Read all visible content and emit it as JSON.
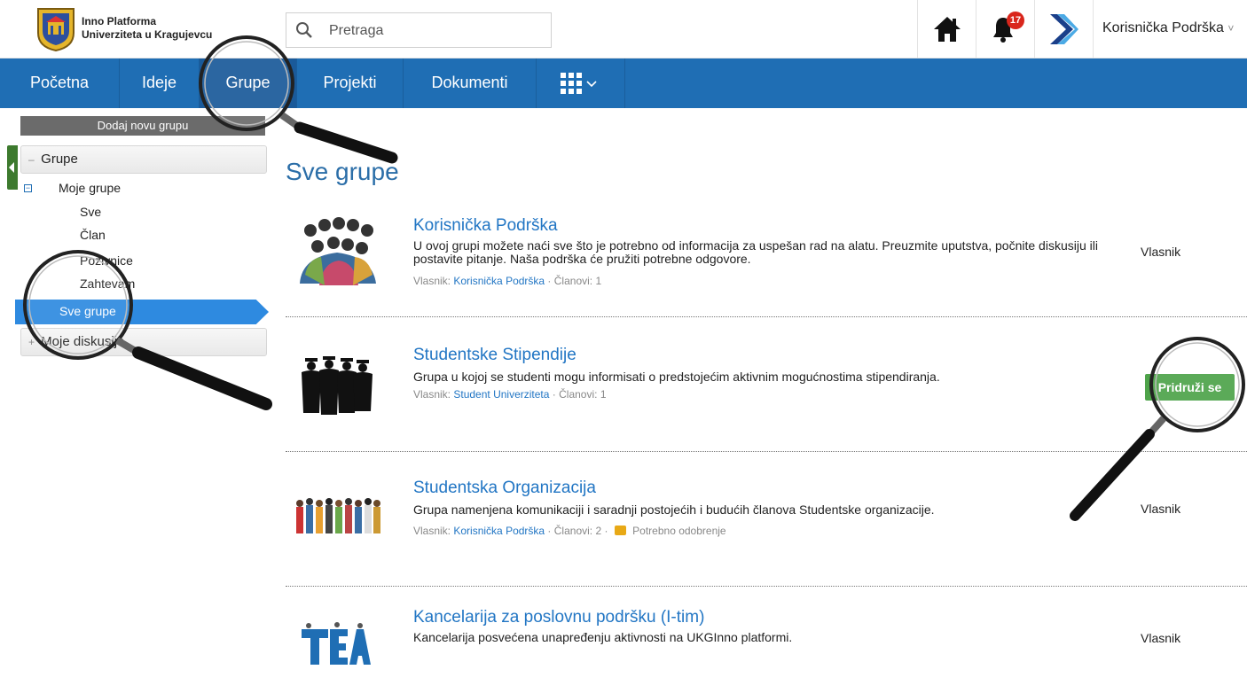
{
  "brand": {
    "line1": "Inno Platforma",
    "line2": "Univerziteta u Kragujevcu"
  },
  "search": {
    "placeholder": "Pretraga"
  },
  "notifications": {
    "count": "17"
  },
  "user": {
    "name": "Korisnička Podrška"
  },
  "nav": {
    "items": [
      "Početna",
      "Ideje",
      "Grupe",
      "Projekti",
      "Dokumenti"
    ],
    "active": "Grupe"
  },
  "sidebar": {
    "add_button": "Dodaj novu grupu",
    "section1": "Grupe",
    "my_groups": "Moje grupe",
    "sub": [
      "Sve",
      "Član",
      "Pozivnice",
      "Zahtevam"
    ],
    "all_groups": "Sve grupe",
    "section2": "Moje diskusije"
  },
  "page": {
    "title": "Sve grupe"
  },
  "labels": {
    "owner": "Vlasnik:",
    "members": "Članovi:",
    "approval": "Potrebno odobrenje"
  },
  "groups": [
    {
      "title": "Korisnička Podrška",
      "description": "U ovoj grupi možete naći sve što je potrebno od informacija za uspešan rad na alatu. Preuzmite uputstva, počnite diskusiju ili postavite pitanje. Naša podrška će pružiti potrebne odgovore.",
      "owner": "Korisnička Podrška",
      "members": "1",
      "role": "Vlasnik"
    },
    {
      "title": "Studentske Stipendije",
      "description": "Grupa u kojoj se studenti mogu informisati o predstojećim aktivnim mogućnostima stipendiranja.",
      "owner": "Student Univerziteta",
      "members": "1",
      "action": "Pridruži se"
    },
    {
      "title": "Studentska Organizacija",
      "description": "Grupa namenjena komunikaciji i saradnji postojećih i budućih članova Studentske organizacije.",
      "owner": "Korisnička Podrška",
      "members": "2",
      "role": "Vlasnik"
    },
    {
      "title": "Kancelarija za poslovnu podršku (I-tim)",
      "description": "Kancelarija posvećena unapređenju aktivnosti na UKGInno platformi.",
      "role": "Vlasnik"
    }
  ],
  "colors": {
    "nav": "#1f6eb4",
    "accent": "#2276c4",
    "join": "#4ea34a",
    "badge": "#d9261c"
  }
}
